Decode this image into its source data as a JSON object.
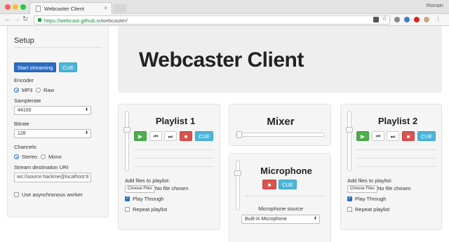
{
  "browser": {
    "tab_title": "Webcaster Client",
    "tab_close": "×",
    "profile_name": "Romain",
    "url_host": "https://webcast.github.io",
    "url_path": "/webcaster/",
    "back_glyph": "←",
    "forward_glyph": "→",
    "reload_glyph": "↻"
  },
  "page_title": "Webcaster Client",
  "setup": {
    "title": "Setup",
    "start_streaming": "Start streaming",
    "cue": "CUE",
    "encoder_label": "Encoder",
    "encoder_options": [
      "MP3",
      "Raw"
    ],
    "encoder_selected": "MP3",
    "samplerate_label": "Samplerate",
    "samplerate_value": "44100",
    "bitrate_label": "Bitrate",
    "bitrate_value": "128",
    "channels_label": "Channels",
    "channels_options": [
      "Stereo",
      "Mono"
    ],
    "channels_selected": "Stereo",
    "uri_label": "Stream destination URI",
    "uri_value": "ws://source:hackme@localhost:8",
    "async_worker_label": "Use asynchronous worker",
    "async_worker_checked": false
  },
  "playlist1": {
    "title": "Playlist 1",
    "cue": "CUE",
    "add_files_label": "Add files to playlist:",
    "choose_files": "Choose Files",
    "no_file": "No file chosen",
    "play_through_label": "Play Through",
    "play_through_checked": true,
    "repeat_label": "Repeat playlist",
    "repeat_checked": false
  },
  "mixer": {
    "title": "Mixer"
  },
  "microphone": {
    "title": "Microphone",
    "cue": "CUE",
    "source_label": "Microphone source",
    "source_value": "Built-in Microphone"
  },
  "playlist2": {
    "title": "Playlist 2",
    "cue": "CUE",
    "add_files_label": "Add files to playlist:",
    "choose_files": "Choose Files",
    "no_file": "No file chosen",
    "play_through_label": "Play Through",
    "play_through_checked": true,
    "repeat_label": "Repeat playlist",
    "repeat_checked": false
  },
  "icons": {
    "play": "▶",
    "prev": "⏮",
    "next": "⏭",
    "stop": "■",
    "record": "■",
    "caret": "▲▼"
  },
  "colors": {
    "primary": "#2b6cc4",
    "info": "#4bb6d9",
    "success": "#4cae4c",
    "danger": "#d9534f"
  }
}
